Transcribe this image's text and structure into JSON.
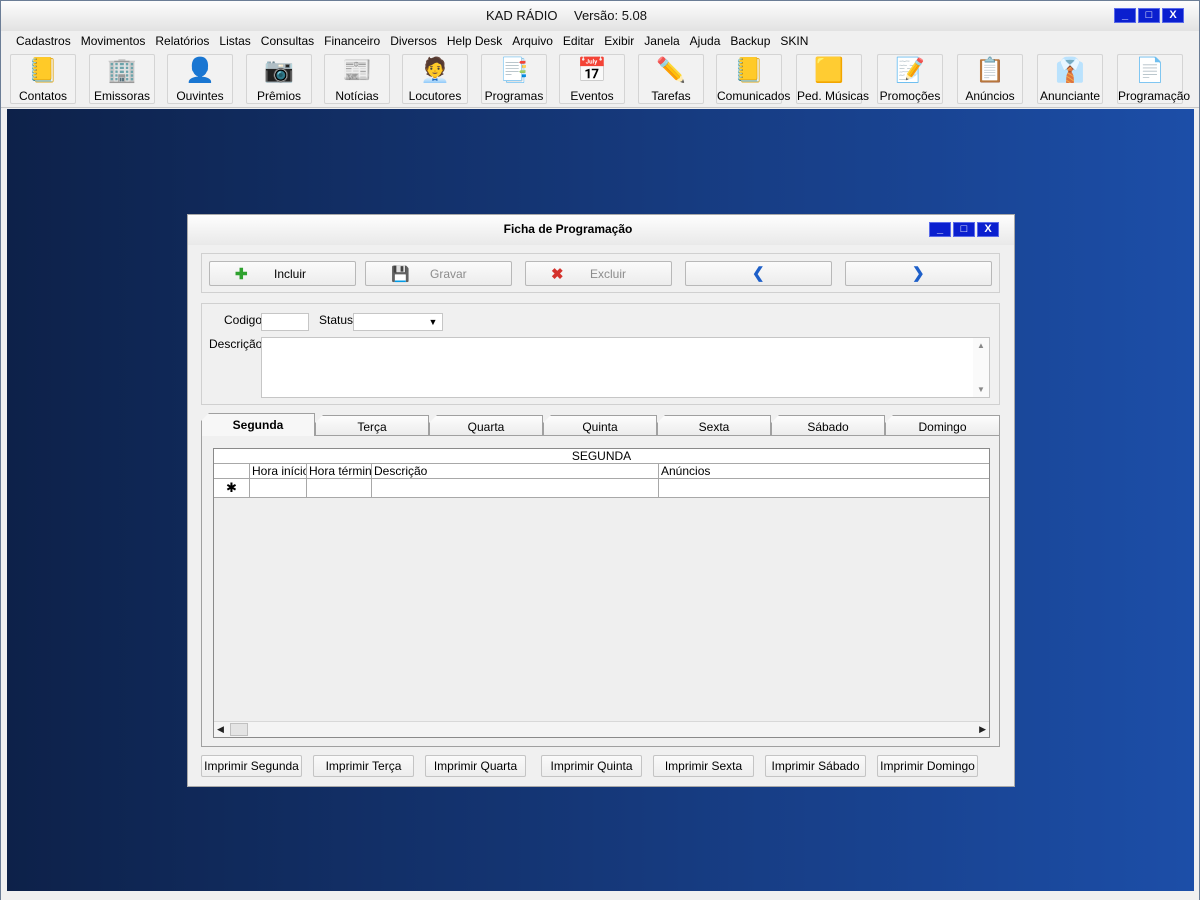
{
  "app": {
    "title": "KAD RÁDIO",
    "version": "Versão: 5.08",
    "window_controls": {
      "minimize": "_",
      "maximize": "□",
      "close": "X"
    }
  },
  "menu": [
    "Cadastros",
    "Movimentos",
    "Relatórios",
    "Listas",
    "Consultas",
    "Financeiro",
    "Diversos",
    "Help Desk",
    "Arquivo",
    "Editar",
    "Exibir",
    "Janela",
    "Ajuda",
    "Backup",
    "SKIN"
  ],
  "toolbar": [
    {
      "label": "Contatos",
      "icon": "address-book-icon"
    },
    {
      "label": "Emissoras",
      "icon": "building-icon"
    },
    {
      "label": "Ouvintes",
      "icon": "listener-icon"
    },
    {
      "label": "Prêmios",
      "icon": "camera-icon"
    },
    {
      "label": "Notícias",
      "icon": "newspaper-icon"
    },
    {
      "label": "Locutores",
      "icon": "announcer-icon"
    },
    {
      "label": "Programas",
      "icon": "document-stack-icon"
    },
    {
      "label": "Eventos",
      "icon": "calendar-icon"
    },
    {
      "label": "Tarefas",
      "icon": "task-icon"
    },
    {
      "label": "Comunicados",
      "icon": "notepad-icon"
    },
    {
      "label": "Ped. Músicas",
      "icon": "sticky-note-icon"
    },
    {
      "label": "Promoções",
      "icon": "promo-note-icon"
    },
    {
      "label": "Anúncios",
      "icon": "ad-note-icon"
    },
    {
      "label": "Anunciante",
      "icon": "advertiser-icon"
    },
    {
      "label": "Programação",
      "icon": "schedule-icon"
    }
  ],
  "dialog": {
    "title": "Ficha de Programação",
    "window_controls": {
      "minimize": "_",
      "maximize": "□",
      "close": "X"
    },
    "actions": {
      "incluir": "Incluir",
      "gravar": "Gravar",
      "excluir": "Excluir"
    },
    "fields": {
      "codigo_label": "Codigo",
      "codigo_value": "",
      "status_label": "Status",
      "status_value": "",
      "descricao_label": "Descrição",
      "descricao_value": ""
    },
    "tabs": [
      "Segunda",
      "Terça",
      "Quarta",
      "Quinta",
      "Sexta",
      "Sábado",
      "Domingo"
    ],
    "active_tab": "Segunda",
    "grid": {
      "caption": "SEGUNDA",
      "columns": [
        "Hora início",
        "Hora término",
        "Descrição",
        "Anúncios"
      ],
      "new_row_marker": "✱",
      "rows": []
    },
    "print_buttons": [
      "Imprimir Segunda",
      "Imprimir Terça",
      "Imprimir Quarta",
      "Imprimir Quinta",
      "Imprimir Sexta",
      "Imprimir Sábado",
      "Imprimir Domingo"
    ]
  }
}
